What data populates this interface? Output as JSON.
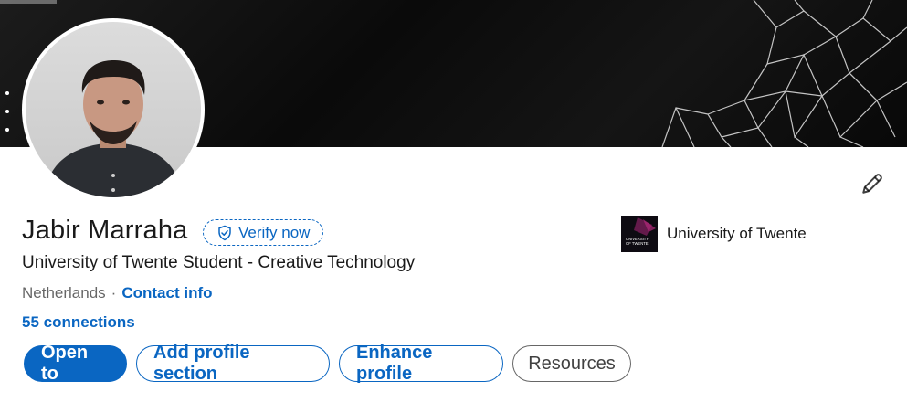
{
  "profile": {
    "name": "Jabir Marraha",
    "verify_label": "Verify now",
    "headline": "University of Twente Student - Creative Technology",
    "location": "Netherlands",
    "separator": "·",
    "contact_label": "Contact info",
    "connections": "55 connections"
  },
  "organization": {
    "name": "University of Twente",
    "logo_text_line1": "UNIVERSITY",
    "logo_text_line2": "OF TWENTE."
  },
  "actions": {
    "open_to": "Open to",
    "add_section": "Add profile section",
    "enhance": "Enhance profile",
    "resources": "Resources"
  },
  "colors": {
    "accent": "#0a66c2",
    "banner": "#111111"
  },
  "icons": {
    "verify": "shield-check-icon",
    "edit": "pencil-icon"
  }
}
